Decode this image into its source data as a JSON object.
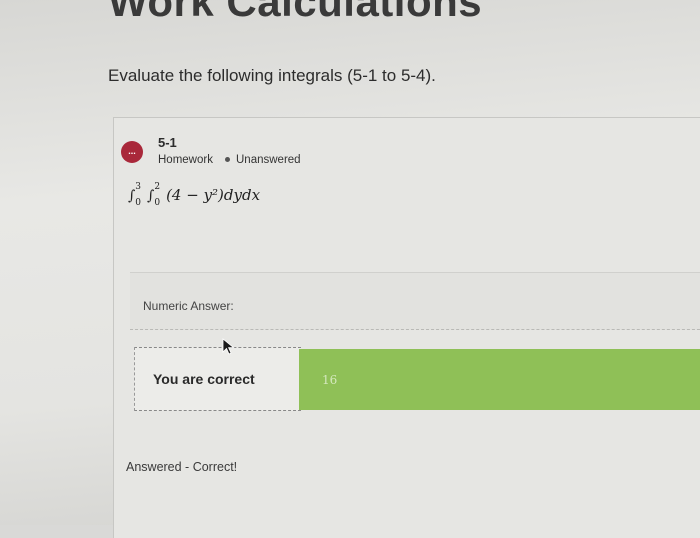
{
  "page": {
    "heading": "Work Calculations",
    "instructions": "Evaluate the following integrals (5-1 to 5-4)."
  },
  "question": {
    "badge_text": "...",
    "number": "5-1",
    "type": "Homework",
    "status": "Unanswered",
    "integral": {
      "outer_upper": "3",
      "outer_lower": "0",
      "inner_upper": "2",
      "inner_lower": "0",
      "integrand": "(4 − y²)dydx"
    }
  },
  "answer": {
    "label": "Numeric Answer:",
    "feedback": "You are correct",
    "value": "16",
    "status_line": "Answered - Correct!"
  },
  "colors": {
    "badge": "#a9283a",
    "correct_fill": "#8fc057"
  }
}
